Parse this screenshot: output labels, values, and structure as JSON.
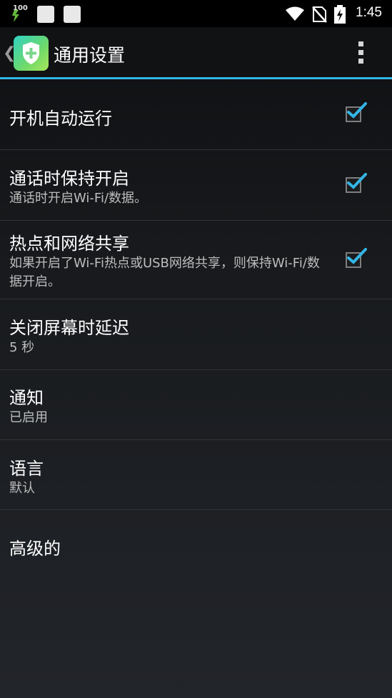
{
  "status_bar": {
    "battery_small_text": "100",
    "time": "1:45",
    "icons": [
      "battery-charging-icon",
      "notification-icon",
      "notification-icon",
      "wifi-icon",
      "no-sim-icon",
      "battery-icon"
    ]
  },
  "action_bar": {
    "back_glyph": "❮",
    "title": "通用设置",
    "app_icon": "shield-icon",
    "overflow_icon": "overflow-menu-icon"
  },
  "settings": {
    "items": [
      {
        "title": "开机自动运行",
        "summary": "",
        "checked": true
      },
      {
        "title": "通话时保持开启",
        "summary": "通话时开启Wi-Fi/数据。",
        "checked": true
      },
      {
        "title": "热点和网络共享",
        "summary": "如果开启了Wi-Fi热点或USB网络共享，则保持Wi-Fi/数据开启。",
        "checked": true
      },
      {
        "title": "关闭屏幕时延迟",
        "summary": "5 秒"
      },
      {
        "title": "通知",
        "summary": "已启用"
      },
      {
        "title": "语言",
        "summary": "默认"
      },
      {
        "title": "高级的",
        "summary": ""
      }
    ]
  },
  "colors": {
    "accent": "#33b5e5",
    "background": "#17191c",
    "summary_text": "#bdbdbd",
    "divider": "#2f3236"
  }
}
